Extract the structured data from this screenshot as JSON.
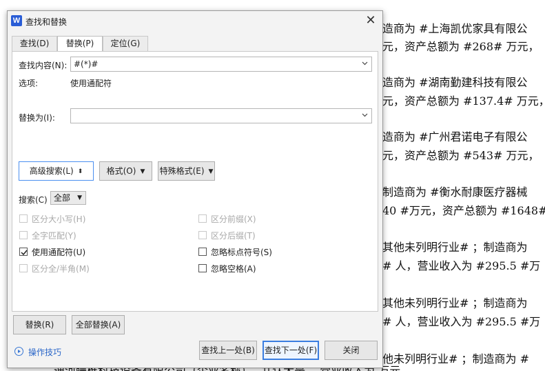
{
  "document": {
    "lines": [
      "造商为 #上海凯优家具有限公",
      "元，资产总额为 #268# 万元，",
      "造商为 #湖南勤建科技有限公",
      "元，资产总额为 #137.4# 万元，",
      "造商为 #广州君诺电子有限公",
      "元，资产总额为 #543# 万元，",
      "制造商为 #衡水耐康医疗器械",
      "40 #万元，资产总额为 #1648#",
      "其他未列明行业# ；制造商为",
      "# 人，营业收入为 #295.5 #万",
      "其他未列明行业# ；制造商为",
      "# 人，营业收入为 #295.5 #万",
      "他未列明行业# ；制造商为 #"
    ],
    "bottom_line": "迪河睡椎科技设备有限公司（企业名称）。 共认大是，           营业收入为           万元"
  },
  "dialog": {
    "app_icon_letter": "W",
    "title": "查找和替换",
    "close_label": "✕",
    "tabs": [
      {
        "label": "查找(D)"
      },
      {
        "label": "替换(P)"
      },
      {
        "label": "定位(G)"
      }
    ],
    "find": {
      "label": "查找内容(N):",
      "value": "#(*)#"
    },
    "options": {
      "label": "选项:",
      "value": "使用通配符"
    },
    "replace": {
      "label": "替换为(I):",
      "value": ""
    },
    "buttons": {
      "advanced": "高级搜索(L)",
      "format": "格式(O)",
      "special": "特殊格式(E)",
      "replace": "替换(R)",
      "replace_all": "全部替换(A)",
      "find_prev": "查找上一处(B)",
      "find_next": "查找下一处(F)",
      "close": "关闭"
    },
    "search": {
      "label": "搜索(C)",
      "value": "全部"
    },
    "checkboxes": [
      {
        "label": "区分大小写(H)",
        "checked": false,
        "disabled": true
      },
      {
        "label": "全字匹配(Y)",
        "checked": false,
        "disabled": true
      },
      {
        "label": "使用通配符(U)",
        "checked": true,
        "disabled": false
      },
      {
        "label": "区分全/半角(M)",
        "checked": false,
        "disabled": true
      },
      {
        "label": "区分前缀(X)",
        "checked": false,
        "disabled": true
      },
      {
        "label": "区分后缀(T)",
        "checked": false,
        "disabled": true
      },
      {
        "label": "忽略标点符号(S)",
        "checked": false,
        "disabled": false
      },
      {
        "label": "忽略空格(A)",
        "checked": false,
        "disabled": false
      }
    ],
    "tips_label": "操作技巧"
  }
}
